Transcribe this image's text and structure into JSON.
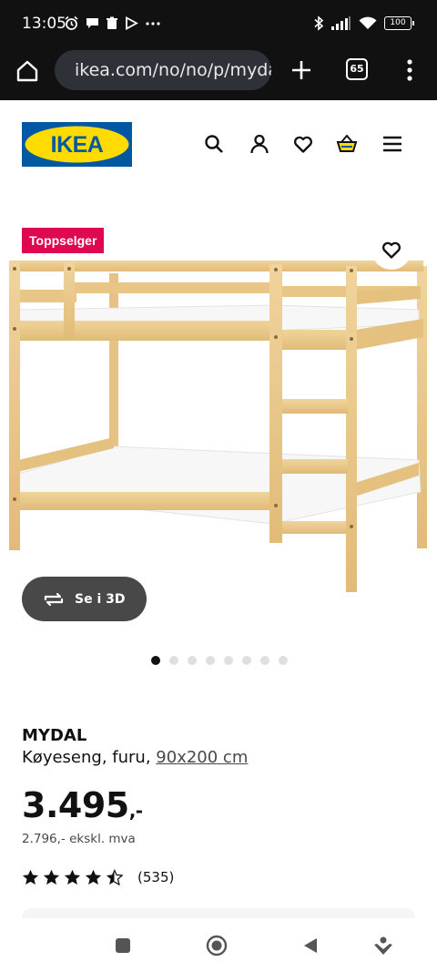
{
  "status_bar": {
    "time": "13:05",
    "battery": "100",
    "left_icons": [
      "alarm-icon",
      "chat-icon",
      "trash-icon",
      "play-icon",
      "more-icon"
    ],
    "right_icons": [
      "bluetooth-icon",
      "signal-icon",
      "wifi-icon",
      "battery-icon"
    ]
  },
  "browser": {
    "url": "ikea.com/no/no/p/mydal-koyeseng",
    "tab_count": "65"
  },
  "header": {
    "logo_text": "IKEA",
    "icons": [
      "search-icon",
      "account-icon",
      "favorites-icon",
      "cart-icon",
      "menu-icon"
    ]
  },
  "product": {
    "badge": "Toppselger",
    "view_3d_label": "Se i 3D",
    "image_count": 8,
    "active_image": 1,
    "name": "MYDAL",
    "description": "Køyeseng, furu,",
    "size": "90x200 cm",
    "price_main": "3.495",
    "price_suffix": ",-",
    "price_ex_vat": "2.796,- ekskl. mva",
    "rating_value": 4.5,
    "rating_max": 5,
    "review_count": "(535)"
  },
  "colors": {
    "ikea_blue": "#0058a3",
    "ikea_yellow": "#ffdb00",
    "badge_red": "#e00751",
    "dark_button": "#484848",
    "pine_wood": "#e9c98e"
  },
  "nav_bar": {
    "icons": [
      "recents-icon",
      "home-icon",
      "back-icon",
      "assistant-icon"
    ]
  }
}
